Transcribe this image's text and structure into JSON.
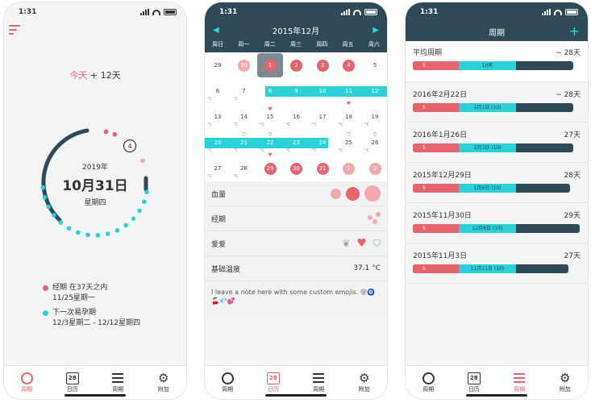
{
  "status_time": "1:31",
  "tabs": [
    {
      "label": "周期"
    },
    {
      "label": "日历",
      "icon_text": "28"
    },
    {
      "label": "周期"
    },
    {
      "label": "附加"
    }
  ],
  "phone1": {
    "today_label": "今天",
    "today_offset": "+ 12天",
    "year": "2019年",
    "date": "10月31日",
    "weekday": "星期四",
    "ring_badge": "4",
    "legend": [
      {
        "line1": "经期 在37天之内",
        "line2": "11/25星期一",
        "color": "#e9636e"
      },
      {
        "line1": "下一次易孕期",
        "line2": "12/3星期二 - 12/12星期四",
        "color": "#27d3d8"
      }
    ]
  },
  "phone2": {
    "month_title": "2015年12月",
    "weekdays": [
      "周日",
      "周一",
      "周二",
      "周三",
      "周四",
      "周五",
      "周六"
    ],
    "rows": [
      [
        "29",
        "30",
        "1",
        "2",
        "3",
        "4",
        "5"
      ],
      [
        "6",
        "7",
        "8",
        "9",
        "10",
        "11",
        "12"
      ],
      [
        "13",
        "14",
        "15",
        "16",
        "17",
        "18",
        "19"
      ],
      [
        "20",
        "21",
        "22",
        "23",
        "24",
        "25",
        "26"
      ],
      [
        "27",
        "28",
        "29",
        "30",
        "31",
        "1",
        "2"
      ]
    ],
    "info": [
      {
        "label": "血量"
      },
      {
        "label": "经期"
      },
      {
        "label": "爱爱"
      },
      {
        "label": "基础温度",
        "value": "37.1 °C"
      }
    ],
    "note": "I leave a note here with some custom emojis. 😜🧿🍒💎💕",
    "deg_label": "°C"
  },
  "phone3": {
    "title": "周期",
    "average": {
      "label": "平均周期",
      "value": "~ 28天",
      "period": "5",
      "fertile": "10天"
    },
    "cycles": [
      {
        "date": "2016年2月22日",
        "length": "~ 28天",
        "period": "5",
        "fertile": "1月1日 (10)"
      },
      {
        "date": "2016年1月26日",
        "length": "27天",
        "period": "5",
        "fertile": "2月3日 (10)"
      },
      {
        "date": "2015年12月29日",
        "length": "28天",
        "period": "5",
        "fertile": "1月6日 (10)"
      },
      {
        "date": "2015年11月30日",
        "length": "29天",
        "period": "5",
        "fertile": "12月8日 (10)"
      },
      {
        "date": "2015年11月3日",
        "length": "27天",
        "period": "5",
        "fertile": "11月11日 (10)"
      }
    ]
  },
  "colors": {
    "accent": "#e9636e",
    "fertile": "#27d3d8",
    "dark": "#2e4a56"
  }
}
